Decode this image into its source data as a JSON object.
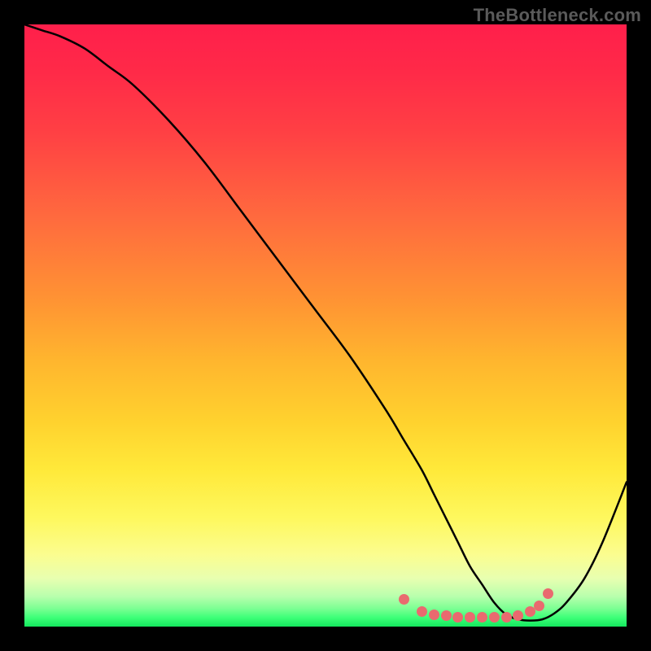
{
  "watermark": "TheBottleneck.com",
  "chart_data": {
    "type": "line",
    "title": "",
    "xlabel": "",
    "ylabel": "",
    "xlim": [
      0,
      100
    ],
    "ylim": [
      0,
      100
    ],
    "grid": false,
    "series": [
      {
        "name": "curve",
        "x": [
          0,
          3,
          6,
          10,
          14,
          18,
          24,
          30,
          36,
          42,
          48,
          54,
          60,
          63,
          66,
          68,
          70,
          72,
          74,
          76,
          78,
          80,
          82,
          84,
          86,
          88,
          90,
          93,
          96,
          100
        ],
        "y": [
          100,
          99,
          98,
          96,
          93,
          90,
          84,
          77,
          69,
          61,
          53,
          45,
          36,
          31,
          26,
          22,
          18,
          14,
          10,
          7,
          4,
          2,
          1.2,
          1,
          1.2,
          2.2,
          4,
          8,
          14,
          24
        ],
        "color": "#000000",
        "stroke_width": 2.5
      }
    ],
    "marker_points": {
      "name": "highlight-dots",
      "color": "#e96a6f",
      "points": [
        {
          "x": 63,
          "y": 4.5
        },
        {
          "x": 66,
          "y": 2.5
        },
        {
          "x": 68,
          "y": 2.0
        },
        {
          "x": 70,
          "y": 1.8
        },
        {
          "x": 72,
          "y": 1.6
        },
        {
          "x": 74,
          "y": 1.5
        },
        {
          "x": 76,
          "y": 1.5
        },
        {
          "x": 78,
          "y": 1.5
        },
        {
          "x": 80,
          "y": 1.6
        },
        {
          "x": 82,
          "y": 1.8
        },
        {
          "x": 84,
          "y": 2.5
        },
        {
          "x": 85.5,
          "y": 3.5
        },
        {
          "x": 87,
          "y": 5.5
        }
      ]
    },
    "background": {
      "type": "vertical-gradient",
      "stops": [
        {
          "pos": 0,
          "color": "#ff1f4b"
        },
        {
          "pos": 50,
          "color": "#ff9433"
        },
        {
          "pos": 80,
          "color": "#fef85e"
        },
        {
          "pos": 100,
          "color": "#14e85e"
        }
      ]
    }
  }
}
